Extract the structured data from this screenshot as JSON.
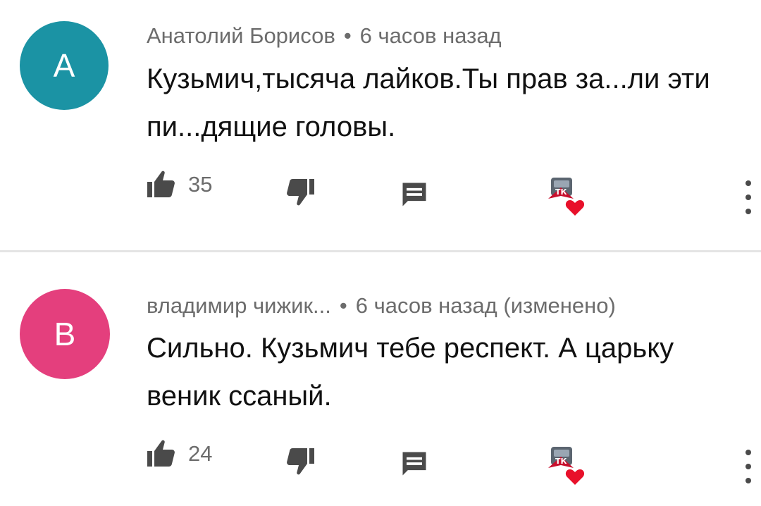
{
  "theme": {
    "text_color": "#111111",
    "meta_color": "#6c6c6c",
    "icon_color": "#4a4a4a",
    "heart_color": "#e8102a",
    "divider_color": "#e4e4e4"
  },
  "comments": [
    {
      "avatar_letter": "A",
      "avatar_color": "#1b93a4",
      "author": "Анатолий Борисов",
      "separator": "•",
      "time": "6 часов назад",
      "edited": "",
      "text": "Кузьмич,тысяча лайков.Ты прав за...ли эти пи...дящие головы.",
      "likes": "35",
      "icons": [
        "thumbs-up-icon",
        "thumbs-down-icon",
        "reply-icon",
        "creator-heart-icon",
        "more-vert-icon"
      ]
    },
    {
      "avatar_letter": "B",
      "avatar_color": "#e43f7d",
      "author": "владимир чижик...",
      "separator": "•",
      "time": "6 часов назад",
      "edited": "(изменено)",
      "text": "Сильно. Кузьмич тебе респект. А царьку веник ссаный.",
      "likes": "24",
      "icons": [
        "thumbs-up-icon",
        "thumbs-down-icon",
        "reply-icon",
        "creator-heart-icon",
        "more-vert-icon"
      ]
    }
  ]
}
